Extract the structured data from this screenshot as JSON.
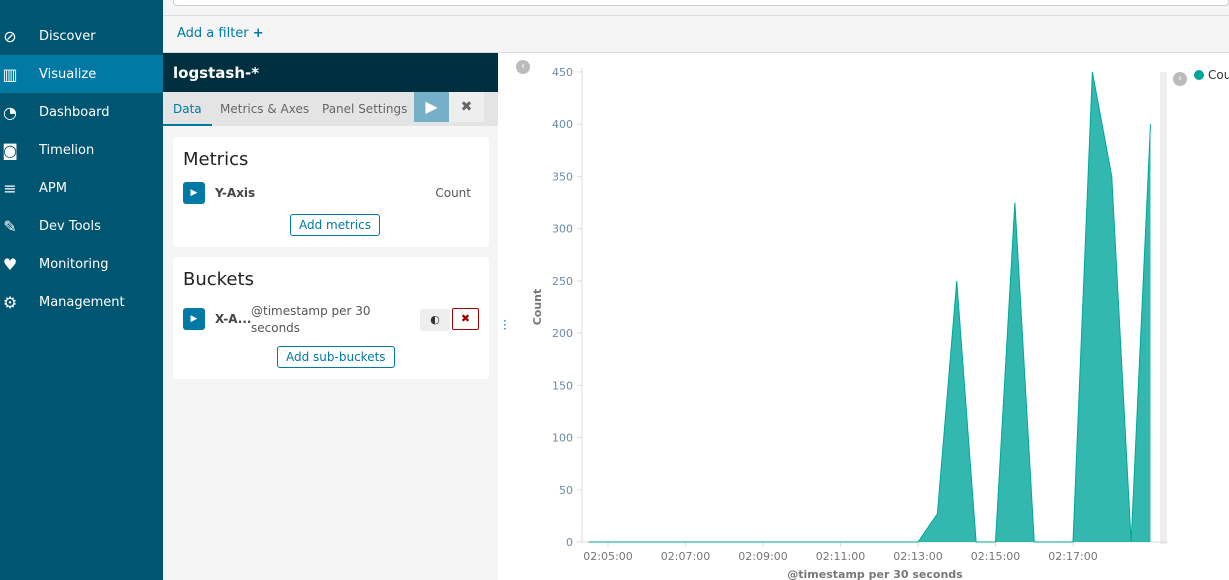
{
  "sidebar": {
    "items": [
      {
        "label": "Discover",
        "icon": "compass-icon",
        "glyph": "⊘"
      },
      {
        "label": "Visualize",
        "icon": "bar-chart-icon",
        "glyph": "▥",
        "active": true
      },
      {
        "label": "Dashboard",
        "icon": "dashboard-icon",
        "glyph": "◔"
      },
      {
        "label": "Timelion",
        "icon": "timelion-icon",
        "glyph": "◙"
      },
      {
        "label": "APM",
        "icon": "apm-icon",
        "glyph": "≡"
      },
      {
        "label": "Dev Tools",
        "icon": "wrench-icon",
        "glyph": "✎"
      },
      {
        "label": "Monitoring",
        "icon": "heartbeat-icon",
        "glyph": "♥"
      },
      {
        "label": "Management",
        "icon": "gear-icon",
        "glyph": "⚙"
      }
    ]
  },
  "filter": {
    "add_label": "Add a filter",
    "plus": "+"
  },
  "editor": {
    "index": "logstash-*",
    "tabs": [
      "Data",
      "Metrics & Axes",
      "Panel Settings"
    ],
    "run": "▶",
    "cancel": "✖",
    "metrics": {
      "title": "Metrics",
      "agg": "Y-Axis",
      "value": "Count",
      "add": "Add metrics"
    },
    "buckets": {
      "title": "Buckets",
      "agg": "X-A...",
      "value": "@timestamp per 30 seconds",
      "add": "Add sub-buckets",
      "remove": "✖"
    }
  },
  "chart_data": {
    "type": "area",
    "xlabel": "@timestamp per 30 seconds",
    "ylabel": "Count",
    "ylim": [
      0,
      450
    ],
    "yticks": [
      0,
      50,
      100,
      150,
      200,
      250,
      300,
      350,
      400,
      450
    ],
    "xticks": [
      "02:05:00",
      "02:07:00",
      "02:09:00",
      "02:11:00",
      "02:13:00",
      "02:15:00",
      "02:17:00"
    ],
    "color": "#00a69b",
    "legend": {
      "label": "Cou",
      "placement": "right"
    },
    "series": [
      {
        "name": "Count",
        "points": [
          [
            "02:04:30",
            0
          ],
          [
            "02:05:00",
            0
          ],
          [
            "02:13:00",
            0
          ],
          [
            "02:13:30",
            27
          ],
          [
            "02:14:00",
            250
          ],
          [
            "02:14:30",
            0
          ],
          [
            "02:15:00",
            0
          ],
          [
            "02:15:30",
            325
          ],
          [
            "02:16:00",
            0
          ],
          [
            "02:16:30",
            0
          ],
          [
            "02:17:00",
            0
          ],
          [
            "02:17:30",
            450
          ],
          [
            "02:18:00",
            350
          ],
          [
            "02:18:30",
            0
          ],
          [
            "02:19:00",
            400
          ]
        ]
      }
    ]
  }
}
